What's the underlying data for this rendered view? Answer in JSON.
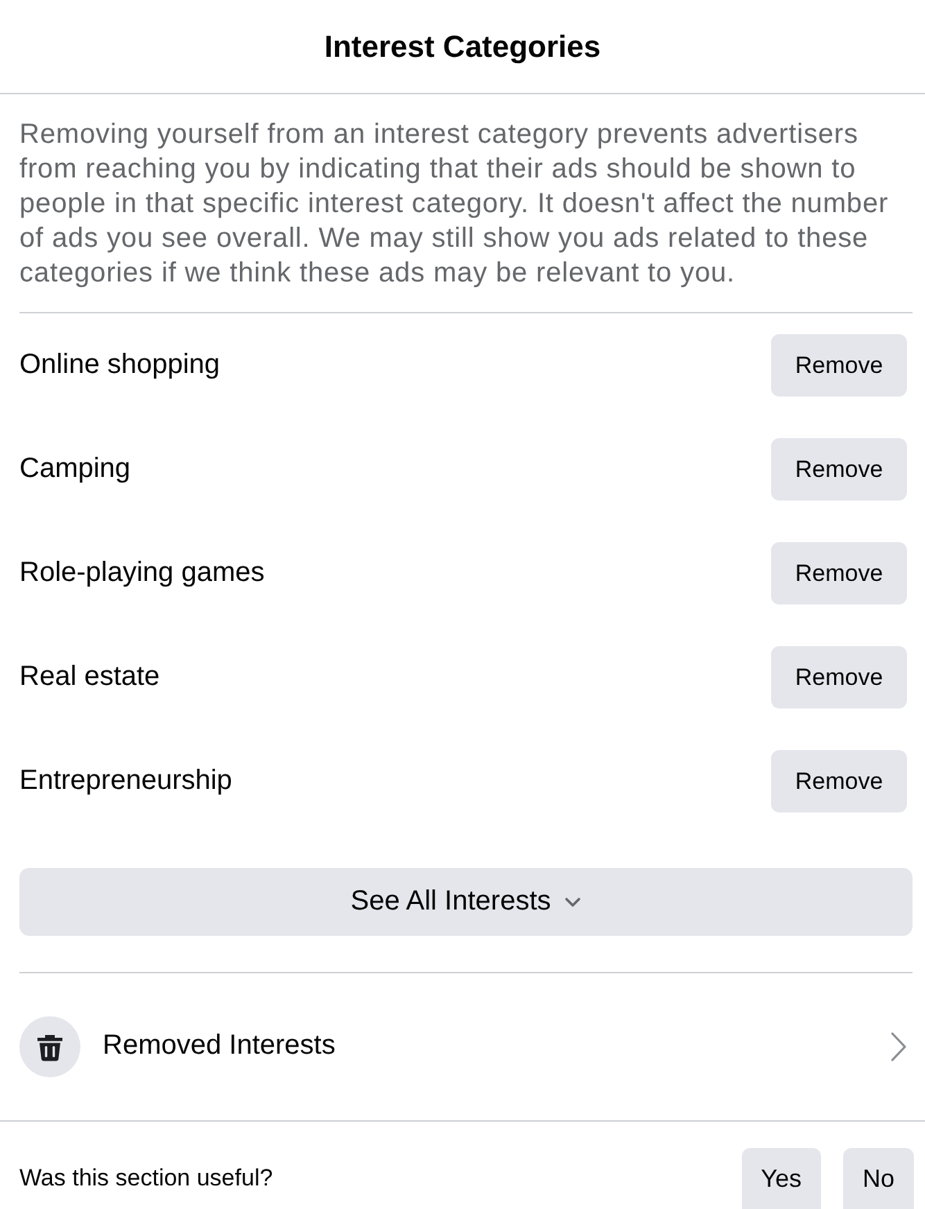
{
  "header": {
    "title": "Interest Categories"
  },
  "description": "Removing yourself from an interest category prevents advertisers from reaching you by indicating that their ads should be shown to people in that specific interest category. It doesn't affect the number of ads you see overall. We may still show you ads related to these categories if we think these ads may be relevant to you.",
  "interests": [
    {
      "name": "Online shopping",
      "action": "Remove"
    },
    {
      "name": "Camping",
      "action": "Remove"
    },
    {
      "name": "Role-playing games",
      "action": "Remove"
    },
    {
      "name": "Real estate",
      "action": "Remove"
    },
    {
      "name": "Entrepreneurship",
      "action": "Remove"
    }
  ],
  "see_all_button": {
    "label": "See All Interests"
  },
  "removed_interests": {
    "label": "Removed Interests"
  },
  "feedback": {
    "question": "Was this section useful?",
    "buttons": [
      "Yes",
      "No"
    ]
  }
}
